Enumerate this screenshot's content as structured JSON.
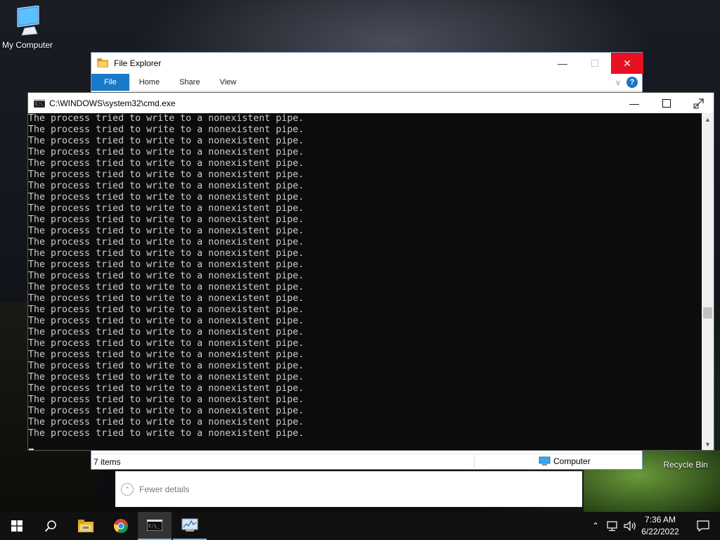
{
  "desktop": {
    "icons": [
      {
        "label": "My Computer"
      },
      {
        "label": "Recycle Bin"
      }
    ]
  },
  "explorer": {
    "title": "File Explorer",
    "ribbon_tabs": [
      "File",
      "Home",
      "Share",
      "View"
    ],
    "status_items": "7 items",
    "status_location": "Computer"
  },
  "dialog": {
    "fewer_details": "Fewer details"
  },
  "cmd": {
    "title": "C:\\WINDOWS\\system32\\cmd.exe",
    "lines": [
      "The process tried to write to a nonexistent pipe.",
      "The process tried to write to a nonexistent pipe.",
      "The process tried to write to a nonexistent pipe.",
      "The process tried to write to a nonexistent pipe.",
      "The process tried to write to a nonexistent pipe.",
      "The process tried to write to a nonexistent pipe.",
      "The process tried to write to a nonexistent pipe.",
      "The process tried to write to a nonexistent pipe.",
      "The process tried to write to a nonexistent pipe.",
      "The process tried to write to a nonexistent pipe.",
      "The process tried to write to a nonexistent pipe.",
      "The process tried to write to a nonexistent pipe.",
      "The process tried to write to a nonexistent pipe.",
      "The process tried to write to a nonexistent pipe.",
      "The process tried to write to a nonexistent pipe.",
      "The process tried to write to a nonexistent pipe.",
      "The process tried to write to a nonexistent pipe.",
      "The process tried to write to a nonexistent pipe.",
      "The process tried to write to a nonexistent pipe.",
      "The process tried to write to a nonexistent pipe.",
      "The process tried to write to a nonexistent pipe.",
      "The process tried to write to a nonexistent pipe.",
      "The process tried to write to a nonexistent pipe.",
      "The process tried to write to a nonexistent pipe.",
      "The process tried to write to a nonexistent pipe.",
      "The process tried to write to a nonexistent pipe.",
      "The process tried to write to a nonexistent pipe.",
      "The process tried to write to a nonexistent pipe.",
      "The process tried to write to a nonexistent pipe."
    ]
  },
  "taskbar": {
    "items": [
      "windows-start-icon",
      "search-icon",
      "file-explorer-icon",
      "chrome-icon",
      "cmd-icon",
      "task-manager-icon"
    ],
    "clock_time": "7:36 AM",
    "clock_date": "6/22/2022"
  },
  "colors": {
    "close_red": "#e81123",
    "ribbon_blue": "#1979ca",
    "taskbar_bg": "#101010",
    "console_bg": "#0c0c0c",
    "console_text": "#cccccc",
    "active_accent": "#76b9ed"
  }
}
